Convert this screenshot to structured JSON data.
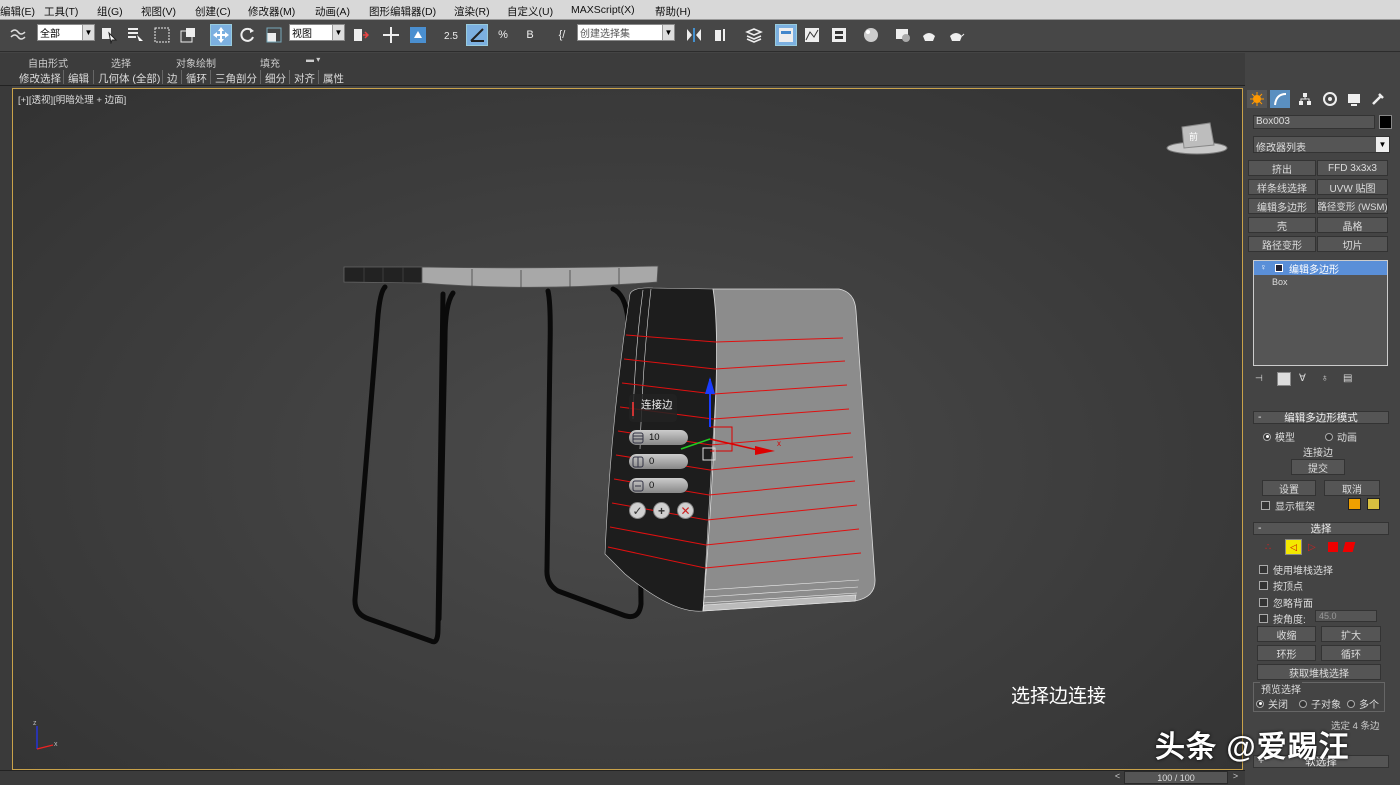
{
  "menubar": {
    "items": [
      "编辑(E)",
      "工具(T)",
      "组(G)",
      "视图(V)",
      "创建(C)",
      "修改器(M)",
      "动画(A)",
      "图形编辑器(D)",
      "渲染(R)",
      "自定义(U)",
      "MAXScript(X)",
      "帮助(H)"
    ]
  },
  "toolbar": {
    "selection_filter": "全部",
    "ref_coord": "视图",
    "snap_label": "2.5",
    "named_selection": "创建选择集"
  },
  "ribbon": {
    "tabs": [
      "自由形式",
      "选择",
      "对象绘制",
      "填充"
    ],
    "tools": [
      "修改选择",
      "编辑",
      "几何体 (全部)",
      "边",
      "循环",
      "三角剖分",
      "细分",
      "对齐",
      "属性"
    ]
  },
  "viewport": {
    "label_plus": "[+]",
    "label_view": "[透视]",
    "label_shading": "[明暗处理 + 边面]",
    "viewcube_text": "前",
    "gizmo_axis_label": "x",
    "axis_z": "z",
    "axis_x": "x",
    "subtitle": "选择边连接"
  },
  "caddy": {
    "title": "连接边",
    "segments": "10",
    "pinch": "0",
    "slide": "0"
  },
  "command_panel": {
    "object_name": "Box003",
    "modifier_list": "修改器列表",
    "modifier_buttons": [
      "挤出",
      "FFD 3x3x3",
      "样条线选择",
      "UVW 贴图",
      "编辑多边形",
      "路径变形 (WSM)",
      "壳",
      "晶格",
      "路径变形",
      "切片"
    ],
    "stack": [
      {
        "label": "编辑多边形",
        "selected": true
      },
      {
        "label": "Box",
        "selected": false
      }
    ],
    "mode_rollout": {
      "title": "编辑多边形模式",
      "radio_model": "模型",
      "radio_animate": "动画",
      "current_op": "连接边",
      "commit": "提交",
      "settings": "设置",
      "cancel": "取消",
      "show_cage": "显示框架",
      "cage_color_1": "#f0a000",
      "cage_color_2": "#d8c040"
    },
    "select_rollout": {
      "title": "选择",
      "use_stack": "使用堆栈选择",
      "by_vertex": "按顶点",
      "ignore_backface": "忽略背面",
      "by_angle": "按角度:",
      "angle_value": "45.0",
      "shrink": "收缩",
      "grow": "扩大",
      "ring": "环形",
      "loop": "循环",
      "get_stack": "获取堆栈选择",
      "preview_group": "预览选择",
      "preview_off": "关闭",
      "preview_sub": "子对象",
      "preview_multi": "多个",
      "selected_count": "选定 4 条边",
      "soft_select": "软选择"
    }
  },
  "timeline": {
    "frame": "100 / 100"
  },
  "watermark": "头条 @爱踢汪"
}
